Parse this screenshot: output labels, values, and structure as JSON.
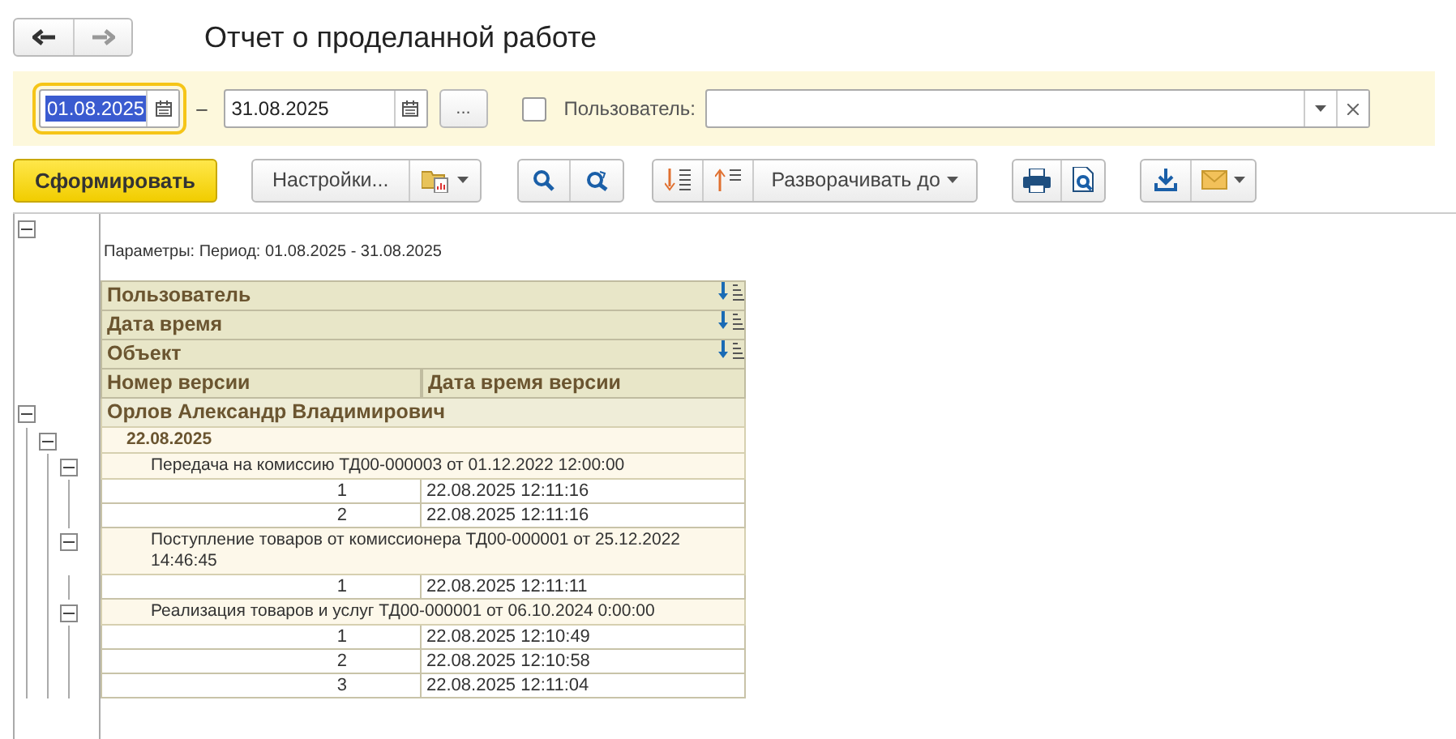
{
  "window": {
    "title": "Отчет о проделанной работе"
  },
  "filters": {
    "date_from": {
      "value": "01.08.2025",
      "focused": true
    },
    "separator": "–",
    "date_to": {
      "value": "31.08.2025",
      "focused": false
    },
    "period_button": "...",
    "user_filter": {
      "label": "Пользователь:",
      "checked": false
    }
  },
  "toolbar": {
    "generate": "Сформировать",
    "settings": "Настройки...",
    "expand_to": "Разворачивать до"
  },
  "report": {
    "parameters": {
      "text": "Параметры: Период: 01.08.2025 - 31.08.2025",
      "expanded": true
    },
    "header_groups": [
      "Пользователь",
      "Дата время",
      "Объект"
    ],
    "columns": [
      "Номер версии",
      "Дата время версии"
    ],
    "groups": [
      {
        "label": "Орлов Александр Владимирович",
        "expanded": true,
        "children": [
          {
            "label": "22.08.2025",
            "expanded": true,
            "children": [
              {
                "label": "Передача на комиссию ТД00-000003 от 01.12.2022 12:00:00",
                "expanded": true,
                "rows": [
                  {
                    "number": "1",
                    "datetime": "22.08.2025 12:11:16"
                  },
                  {
                    "number": "2",
                    "datetime": "22.08.2025 12:11:16"
                  }
                ]
              },
              {
                "label": "Поступление товаров от комиссионера ТД00-000001 от 25.12.2022 14:46:45",
                "expanded": true,
                "rows": [
                  {
                    "number": "1",
                    "datetime": "22.08.2025 12:11:11"
                  }
                ]
              },
              {
                "label": "Реализация товаров и услуг ТД00-000001 от 06.10.2024 0:00:00",
                "expanded": true,
                "rows": [
                  {
                    "number": "1",
                    "datetime": "22.08.2025 12:10:49"
                  },
                  {
                    "number": "2",
                    "datetime": "22.08.2025 12:10:58"
                  },
                  {
                    "number": "3",
                    "datetime": "22.08.2025 12:11:04"
                  }
                ]
              }
            ]
          }
        ]
      }
    ]
  }
}
